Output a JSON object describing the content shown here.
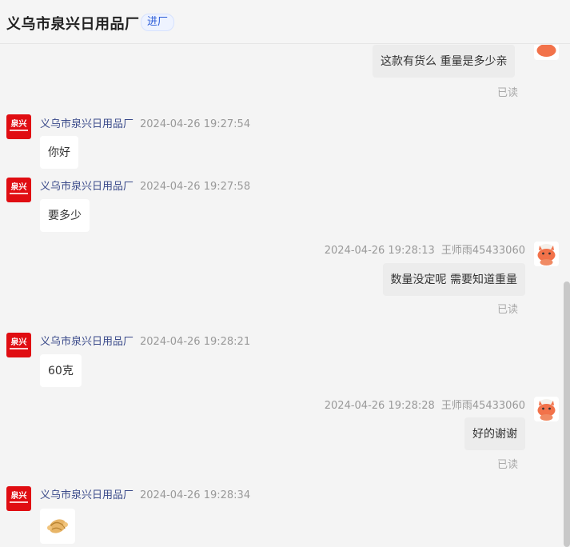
{
  "header": {
    "title": "义乌市泉兴日用品厂",
    "tag": "进厂"
  },
  "shop": {
    "name": "义乌市泉兴日用品厂",
    "avatar_text": "泉兴",
    "brand_color": "#e00d12"
  },
  "user": {
    "name": "王师雨45433060",
    "avatar_icon": "cartoon-fox-icon"
  },
  "read_label": "已读",
  "messages": [
    {
      "dir": "out",
      "text": "这款有货么 重量是多少亲",
      "status": "已读"
    },
    {
      "dir": "in",
      "time": "2024-04-26 19:27:54",
      "text": "你好"
    },
    {
      "dir": "in",
      "time": "2024-04-26 19:27:58",
      "text": "要多少"
    },
    {
      "dir": "out",
      "time": "2024-04-26 19:28:13",
      "text": "数量没定呢  需要知道重量",
      "status": "已读"
    },
    {
      "dir": "in",
      "time": "2024-04-26 19:28:21",
      "text": "60克"
    },
    {
      "dir": "out",
      "time": "2024-04-26 19:28:28",
      "text": "好的谢谢",
      "status": "已读"
    },
    {
      "dir": "in",
      "time": "2024-04-26 19:28:34",
      "emoji": "handshake-icon"
    }
  ]
}
